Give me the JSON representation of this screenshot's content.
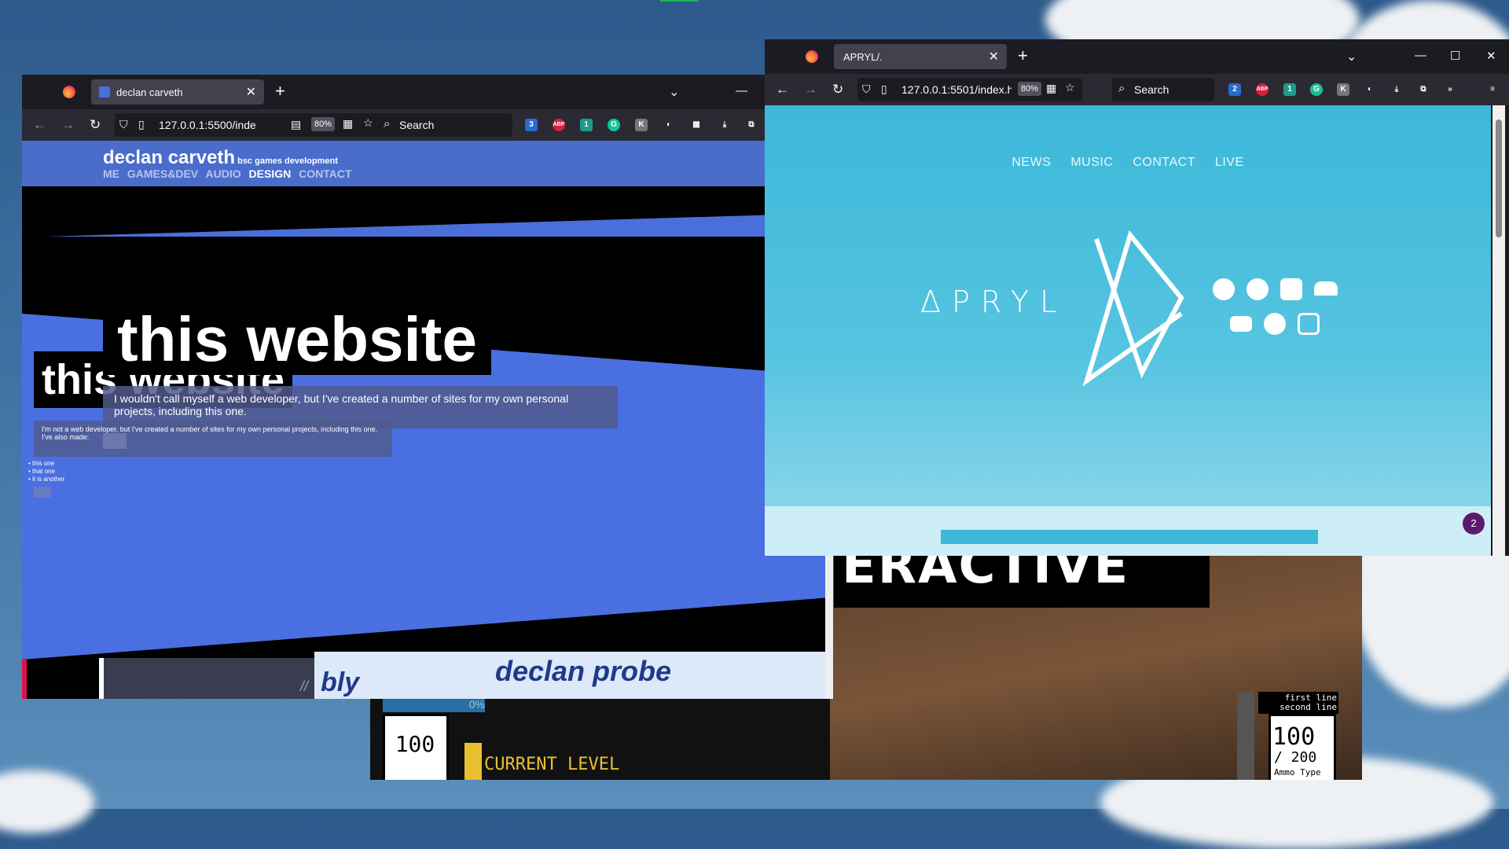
{
  "left_window": {
    "tab_title": "declan carveth",
    "url": "127.0.0.1:5500/inde",
    "zoom": "80%",
    "search_placeholder": "Search",
    "ext_badges": {
      "first": "3",
      "third": "1"
    },
    "page": {
      "name": "declan carveth",
      "subtitle": "bsc games development",
      "nav": [
        "ME",
        "GAMES&DEV",
        "AUDIO",
        "DESIGN",
        "CONTACT"
      ],
      "active_nav": "DESIGN",
      "heading_big": "this website",
      "heading_small": "this website",
      "para_big": "I wouldn't call myself a web developer, but I've created a number of sites for my own personal projects, including this one.",
      "para_small": "I'm not a web developer, but I've created a number of sites for my own personal projects, including this one.",
      "also_made": "I've also made:",
      "list": [
        "this one",
        "that one",
        "it is another"
      ],
      "bottom_text_1": "bly",
      "bottom_text_2": "declan probe",
      "pause_glyph": "//"
    }
  },
  "right_window": {
    "tab_title": "APRYL/.",
    "url": "127.0.0.1:5501/index.h",
    "zoom": "80%",
    "search_placeholder": "Search",
    "ext_badges": {
      "first": "2",
      "third": "1"
    },
    "page": {
      "nav": [
        "NEWS",
        "MUSIC",
        "CONTACT",
        "LIVE"
      ],
      "wordmark": "ΔPRYL",
      "social_icons": [
        "bandcamp-icon",
        "spotify-icon",
        "apple-music-icon",
        "soundcloud-icon",
        "youtube-icon",
        "facebook-icon",
        "instagram-icon"
      ],
      "badge_count": "2"
    }
  },
  "game_window": {
    "banner": "ERACTIVE",
    "health": "100",
    "level_label": "CURRENT LEVEL",
    "percent": "0%",
    "ammo_current": "100",
    "ammo_max": "/ 200",
    "ammo_type": "Ammo Type",
    "note_line_1": "first line",
    "note_line_2": "second line"
  },
  "colors": {
    "left_accent": "#4a6fe0",
    "right_sky": "#3cb8d9",
    "browser_dark": "#1c1b22"
  }
}
